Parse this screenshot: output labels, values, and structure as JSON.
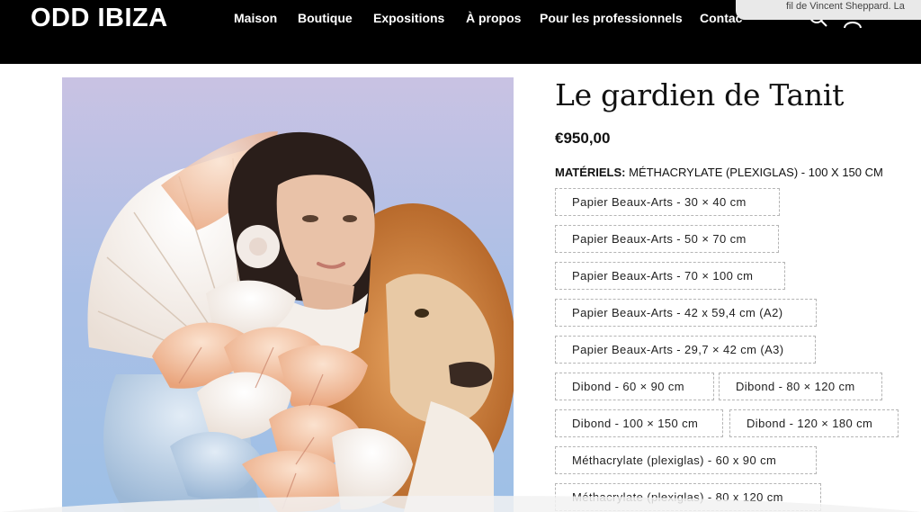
{
  "header": {
    "logo": "ODD IBIZA",
    "nav": [
      "Maison",
      "Boutique",
      "Expositions",
      "À propos",
      "Pour les professionnels",
      "Contac"
    ],
    "toast_text": "fil de Vincent Sheppard. La"
  },
  "product": {
    "title": "Le gardien de Tanit",
    "price": "€950,00",
    "materials_label": "MATÉRIELS:",
    "materials_value": "MÉTHACRYLATE (PLEXIGLAS) - 100 X 150 CM",
    "options": [
      "Papier Beaux-Arts - 30 × 40 cm",
      "Papier Beaux-Arts - 50 × 70 cm",
      "Papier Beaux-Arts - 70 × 100 cm",
      "Papier Beaux-Arts - 42 x 59,4 cm (A2)",
      "Papier Beaux-Arts - 29,7 × 42 cm (A3)",
      "Dibond - 60 × 90 cm",
      "Dibond - 80 × 120 cm",
      "Dibond - 100 × 150 cm",
      "Dibond - 120 × 180 cm",
      "Méthacrylate (plexiglas) - 60 x 90 cm",
      "Méthacrylate (plexiglas) - 80 x 120 cm"
    ]
  },
  "icons": [
    "search-icon",
    "account-icon"
  ],
  "colors": {
    "header_bg": "#000000",
    "header_text": "#ffffff",
    "option_border": "#b5b5b5"
  }
}
